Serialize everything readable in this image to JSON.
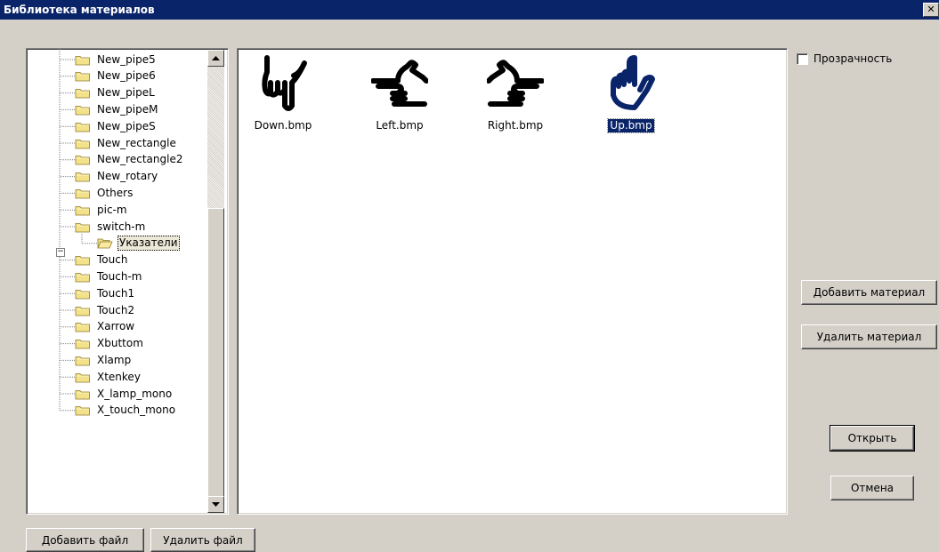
{
  "window": {
    "title": "Библиотека материалов",
    "close_label": "✕"
  },
  "tree": {
    "items": [
      {
        "label": "New_pipe5",
        "level": 1
      },
      {
        "label": "New_pipe6",
        "level": 1
      },
      {
        "label": "New_pipeL",
        "level": 1
      },
      {
        "label": "New_pipeM",
        "level": 1
      },
      {
        "label": "New_pipeS",
        "level": 1
      },
      {
        "label": "New_rectangle",
        "level": 1
      },
      {
        "label": "New_rectangle2",
        "level": 1
      },
      {
        "label": "New_rotary",
        "level": 1
      },
      {
        "label": "Others",
        "level": 1
      },
      {
        "label": "pic-m",
        "level": 1
      },
      {
        "label": "switch-m",
        "level": 1,
        "expanded": true
      },
      {
        "label": "Указатели",
        "level": 2,
        "selected": true,
        "open": true
      },
      {
        "label": "Touch",
        "level": 1
      },
      {
        "label": "Touch-m",
        "level": 1
      },
      {
        "label": "Touch1",
        "level": 1
      },
      {
        "label": "Touch2",
        "level": 1
      },
      {
        "label": "Xarrow",
        "level": 1
      },
      {
        "label": "Xbuttom",
        "level": 1
      },
      {
        "label": "Xlamp",
        "level": 1
      },
      {
        "label": "Xtenkey",
        "level": 1
      },
      {
        "label": "X_lamp_mono",
        "level": 1
      },
      {
        "label": "X_touch_mono",
        "level": 1
      }
    ]
  },
  "files": [
    {
      "label": "Down.bmp",
      "icon": "hand-pointing-down-icon"
    },
    {
      "label": "Left.bmp",
      "icon": "hand-pointing-left-icon"
    },
    {
      "label": "Right.bmp",
      "icon": "hand-pointing-right-icon"
    },
    {
      "label": "Up.bmp",
      "icon": "hand-pointing-up-icon",
      "selected": true
    }
  ],
  "options": {
    "transparency_label": "Прозрачность",
    "transparency_checked": false
  },
  "buttons": {
    "add_material": "Добавить материал",
    "delete_material": "Удалить материал",
    "open": "Открыть",
    "cancel": "Отмена",
    "add_file": "Добавить файл",
    "delete_file": "Удалить файл"
  },
  "colors": {
    "titlebar": "#0a246a",
    "face": "#d4d0c8",
    "folder": "#f4e28a",
    "selection": "#0a246a",
    "up_icon": "#0a246a"
  }
}
